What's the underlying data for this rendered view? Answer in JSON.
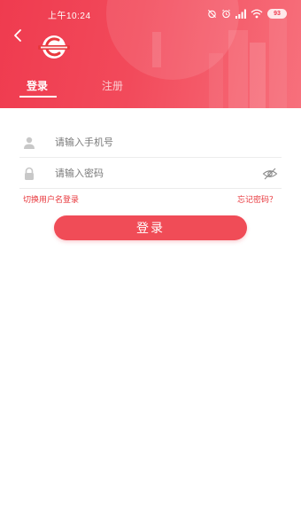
{
  "status_bar": {
    "time": "上午10:24",
    "battery": "93",
    "icons": [
      "alarm-off-icon",
      "alarm-clock-icon",
      "signal-icon",
      "wifi-icon",
      "battery-icon"
    ]
  },
  "header": {
    "back_icon": "chevron-left-icon",
    "logo_icon": "brand-logo-icon"
  },
  "tabs": [
    {
      "label": "登录",
      "active": true
    },
    {
      "label": "注册",
      "active": false
    }
  ],
  "form": {
    "phone": {
      "placeholder": "请输入手机号",
      "value": "",
      "icon": "user-icon"
    },
    "password": {
      "placeholder": "请输入密码",
      "value": "",
      "icon": "lock-icon",
      "toggle_icon": "eye-hidden-icon"
    }
  },
  "links": {
    "switch_login": "切换用户名登录",
    "forgot_password": "忘记密码？"
  },
  "login_button": {
    "label": "登录"
  },
  "colors": {
    "brand_red": "#ef3b4f",
    "button_red": "#f04c57",
    "link_red": "#e8383d"
  }
}
